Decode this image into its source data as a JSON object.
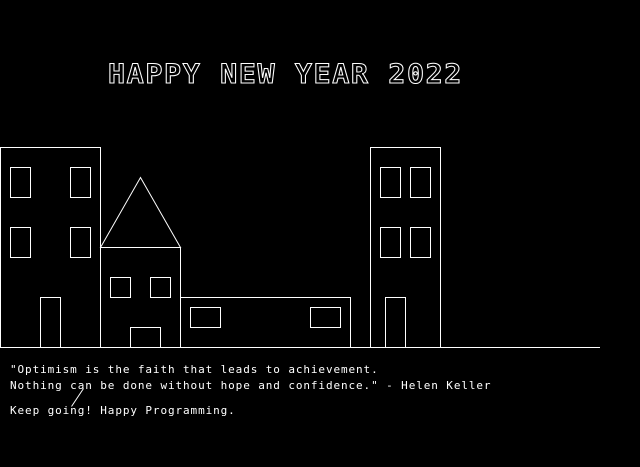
{
  "scene": {
    "title": "HAPPY NEW YEAR 2022",
    "quote_line_1": "\"Optimism is the faith that leads to achievement.",
    "quote_line_2": "Nothing can be done without hope and confidence.\" - Helen Keller",
    "sign_off": "Keep going! Happy Programming."
  },
  "colors": {
    "background": "#000000",
    "foreground": "#ffffff"
  }
}
